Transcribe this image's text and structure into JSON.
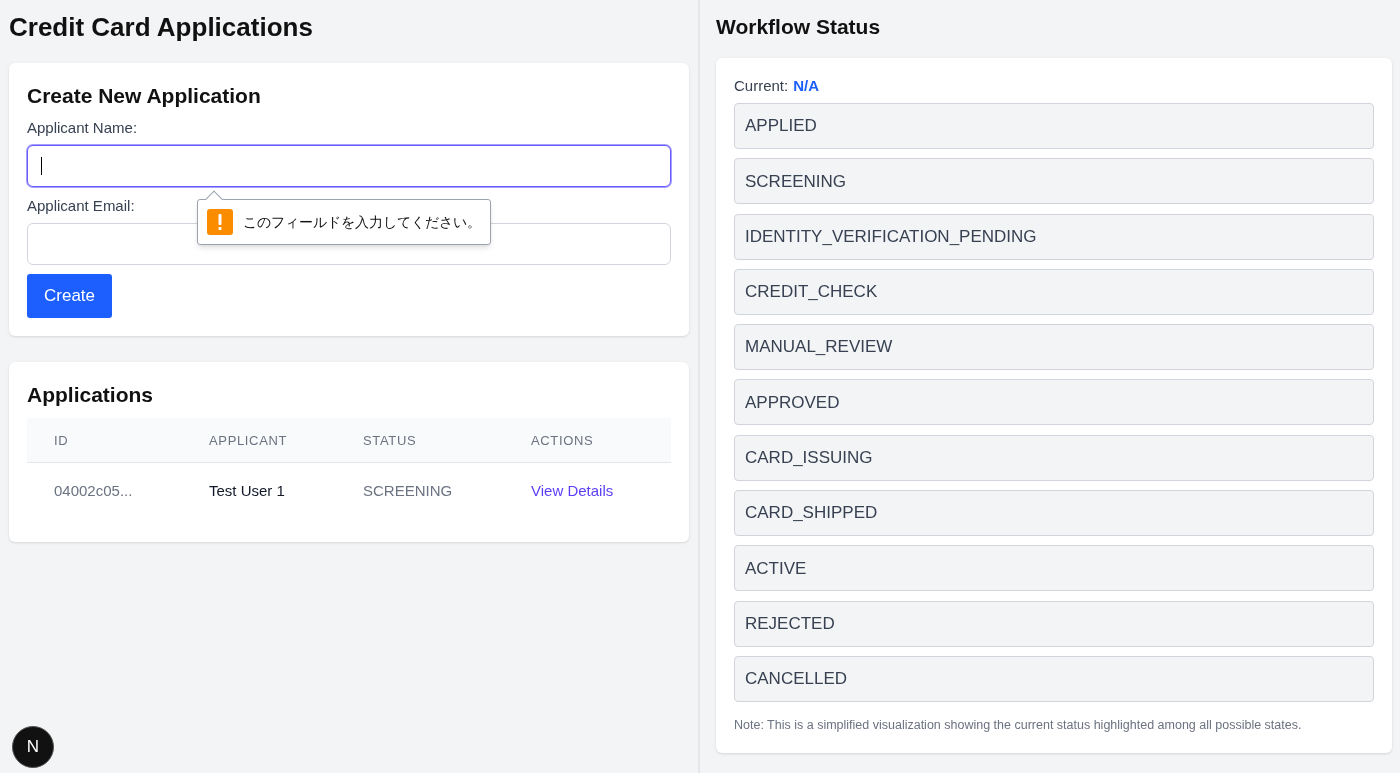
{
  "page_title": "Credit Card Applications",
  "create_form": {
    "title": "Create New Application",
    "fields": [
      {
        "label": "Applicant Name:",
        "focused": true
      },
      {
        "label": "Applicant Email:",
        "focused": false
      }
    ],
    "validation_tooltip": "このフィールドを入力してください。",
    "button": "Create"
  },
  "applications": {
    "title": "Applications",
    "columns": [
      "ID",
      "APPLICANT",
      "STATUS",
      "ACTIONS"
    ],
    "rows": [
      {
        "id": "04002c05...",
        "applicant": "Test User 1",
        "status": "SCREENING",
        "action": "View Details"
      }
    ]
  },
  "workflow": {
    "title": "Workflow Status",
    "current_label": "Current:",
    "current_value": "N/A",
    "states": [
      {
        "label": "APPLIED",
        "selected": false
      },
      {
        "label": "SCREENING",
        "selected": false
      },
      {
        "label": "IDENTITY_VERIFICATION_PENDING",
        "selected": false
      },
      {
        "label": "CREDIT_CHECK",
        "selected": false
      },
      {
        "label": "MANUAL_REVIEW",
        "selected": false
      },
      {
        "label": "APPROVED",
        "selected": false
      },
      {
        "label": "CARD_ISSUING",
        "selected": false
      },
      {
        "label": "CARD_SHIPPED",
        "selected": false
      },
      {
        "label": "ACTIVE",
        "selected": false
      },
      {
        "label": "REJECTED",
        "selected": false
      },
      {
        "label": "CANCELLED",
        "selected": false
      }
    ],
    "note": "Note: This is a simplified visualization showing the current status highlighted among all possible states."
  },
  "dev_badge": "N"
}
